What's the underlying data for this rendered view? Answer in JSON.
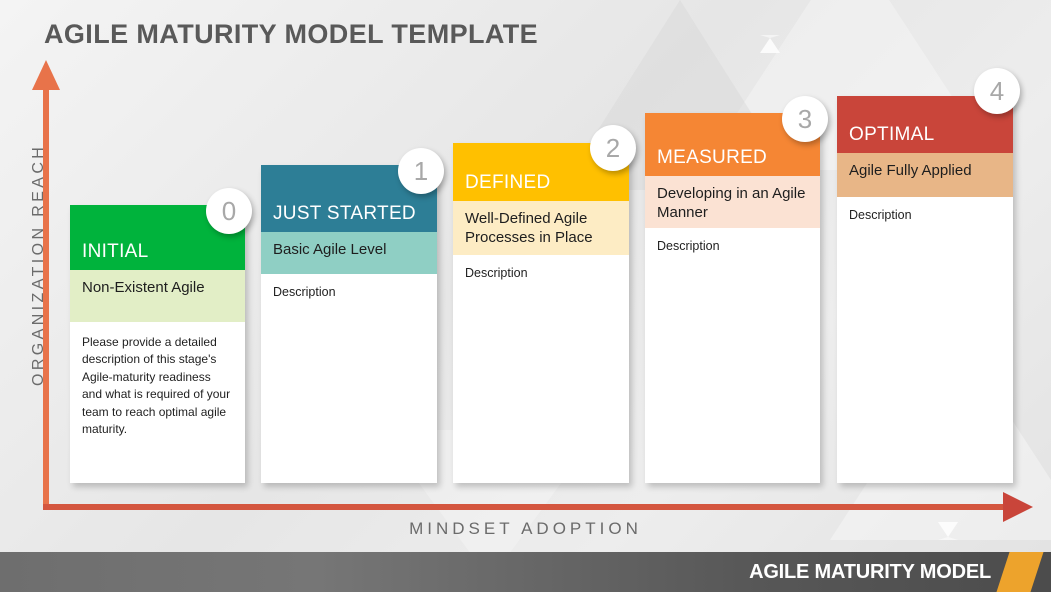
{
  "title": "AGILE MATURITY MODEL TEMPLATE",
  "axes": {
    "y_label": "ORGANIZATION REACH",
    "x_label": "MINDSET ADOPTION",
    "y_arrow_icon": "arrow-up-icon",
    "x_arrow_icon": "arrow-right-icon",
    "accent_color": "#e8734a"
  },
  "footer": {
    "label": "AGILE MATURITY MODEL",
    "accent_color": "#eda32c"
  },
  "stages": [
    {
      "badge": "0",
      "name": "INITIAL",
      "subtitle": "Non-Existent Agile",
      "description": "Please provide a detailed description of this stage's Agile-maturity readiness and what is required of your team to reach optimal agile maturity.",
      "header_color": "#00b33c",
      "subtitle_color": "#e2eec6"
    },
    {
      "badge": "1",
      "name": "JUST STARTED",
      "subtitle": "Basic Agile Level",
      "description": "Description",
      "header_color": "#2d7e96",
      "subtitle_color": "#8fcfc4"
    },
    {
      "badge": "2",
      "name": "DEFINED",
      "subtitle": "Well-Defined Agile Processes in Place",
      "description": "Description",
      "header_color": "#ffc000",
      "subtitle_color": "#fdecc4"
    },
    {
      "badge": "3",
      "name": "MEASURED",
      "subtitle": "Developing in an Agile Manner",
      "description": "Description",
      "header_color": "#f58634",
      "subtitle_color": "#fbe2d3"
    },
    {
      "badge": "4",
      "name": "OPTIMAL",
      "subtitle": "Agile Fully Applied",
      "description": "Description",
      "header_color": "#c9453a",
      "subtitle_color": "#e8b687"
    }
  ]
}
